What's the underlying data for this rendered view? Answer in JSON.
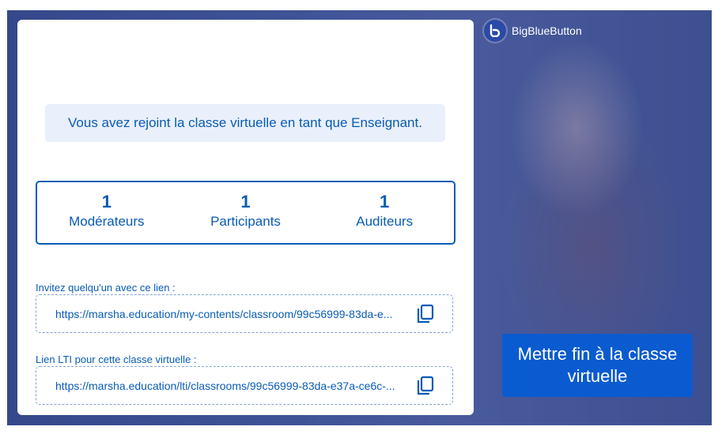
{
  "brand": {
    "name": "BigBlueButton"
  },
  "banner": {
    "text": "Vous avez rejoint la classe virtuelle en tant que Enseignant."
  },
  "stats": [
    {
      "count": "1",
      "label": "Modérateurs"
    },
    {
      "count": "1",
      "label": "Participants"
    },
    {
      "count": "1",
      "label": "Auditeurs"
    }
  ],
  "invite": {
    "label": "Invitez quelqu'un avec ce lien :",
    "url": "https://marsha.education/my-contents/classroom/99c56999-83da-e..."
  },
  "lti": {
    "label": "Lien LTI pour cette classe virtuelle :",
    "url": "https://marsha.education/lti/classrooms/99c56999-83da-e37a-ce6c-..."
  },
  "end_button": {
    "label": "Mettre fin à la classe virtuelle"
  },
  "icons": {
    "brand": "bigbluebutton-logo-icon",
    "copy": "copy-icon"
  },
  "colors": {
    "accent": "#0a5bb5",
    "button": "#0a5bd0",
    "banner_bg": "#e9f0fb"
  }
}
